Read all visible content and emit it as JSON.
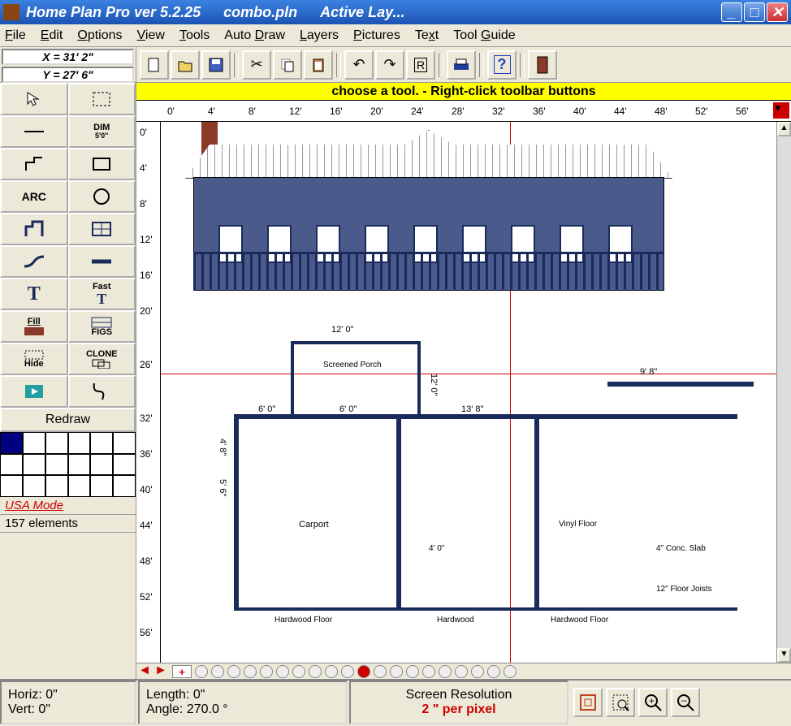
{
  "titlebar": {
    "app": "Home Plan Pro ver 5.2.25",
    "file": "combo.pln",
    "layer": "Active Lay..."
  },
  "menu": [
    "File",
    "Edit",
    "Options",
    "View",
    "Tools",
    "Auto Draw",
    "Layers",
    "Pictures",
    "Text",
    "Tool Guide"
  ],
  "coords": {
    "x": "X = 31' 2\"",
    "y": "Y = 27' 6\""
  },
  "hint": "choose a tool.  -  Right-click toolbar buttons",
  "ruler_h": [
    "0'",
    "4'",
    "8'",
    "12'",
    "16'",
    "20'",
    "24'",
    "28'",
    "32'",
    "36'",
    "40'",
    "44'",
    "48'",
    "52'",
    "56'"
  ],
  "ruler_v": [
    "0'",
    "4'",
    "8'",
    "12'",
    "16'",
    "20'",
    "26'",
    "32'",
    "36'",
    "40'",
    "44'",
    "48'",
    "52'",
    "56'"
  ],
  "tools": {
    "dim_label": "DIM",
    "dim_sub": "5'0\"",
    "arc": "ARC",
    "text_T": "T",
    "fast_T": "Fast",
    "fill": "Fill",
    "figs": "FIGS",
    "hide": "Hide",
    "clone": "CLONE",
    "redraw": "Redraw"
  },
  "mode": "USA Mode",
  "elements": "157 elements",
  "floorplan_labels": {
    "dim1": "12' 0\"",
    "dim2": "12' 0\"",
    "dim3": "6' 0\"",
    "dim4": "6' 0\"",
    "dim5": "13' 8\"",
    "dim6": "9' 8\"",
    "dim7": "5' 6\"",
    "dim8": "4' 8\"",
    "porch": "Screened Porch",
    "carport": "Carport",
    "hardwood1": "Hardwood Floor",
    "hardwood2": "Hardwood",
    "hardwood3": "Hardwood Floor",
    "vinyl": "Vinyl Floor",
    "conc": "4\" Conc. Slab",
    "joists": "12\" Floor Joists",
    "w400": "4' 0\""
  },
  "status": {
    "horiz": "Horiz:  0\"",
    "vert": "Vert:   0\"",
    "length": "Length:  0\"",
    "angle": "Angle: 270.0 °",
    "res_label": "Screen Resolution",
    "res_value": "2 \" per pixel"
  }
}
